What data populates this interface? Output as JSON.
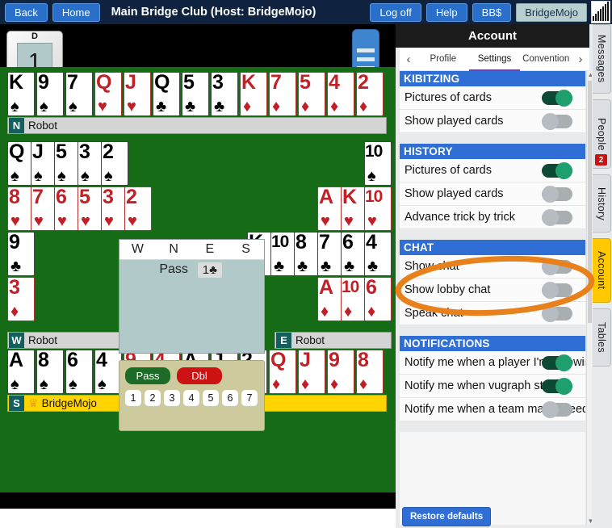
{
  "topbar": {
    "back_label": "Back",
    "home_label": "Home",
    "title": "Main Bridge Club (Host: BridgeMojo)",
    "logoff_label": "Log off",
    "help_label": "Help",
    "bbs_label": "BB$",
    "user_label": "BridgeMojo",
    "logo_icon": "bars-logo-icon"
  },
  "table": {
    "board_number": "1",
    "dealer_marker": "D",
    "menu_icon": "hamburger-menu-icon",
    "hands": {
      "north": {
        "seat": "N",
        "player": "Robot",
        "cards": [
          {
            "rank": "K",
            "suit": "♠",
            "color": "black"
          },
          {
            "rank": "9",
            "suit": "♠",
            "color": "black"
          },
          {
            "rank": "7",
            "suit": "♠",
            "color": "black"
          },
          {
            "rank": "Q",
            "suit": "♥",
            "color": "red"
          },
          {
            "rank": "J",
            "suit": "♥",
            "color": "red"
          },
          {
            "rank": "Q",
            "suit": "♣",
            "color": "black"
          },
          {
            "rank": "5",
            "suit": "♣",
            "color": "black"
          },
          {
            "rank": "3",
            "suit": "♣",
            "color": "black"
          },
          {
            "rank": "K",
            "suit": "♦",
            "color": "red"
          },
          {
            "rank": "7",
            "suit": "♦",
            "color": "red"
          },
          {
            "rank": "5",
            "suit": "♦",
            "color": "red"
          },
          {
            "rank": "4",
            "suit": "♦",
            "color": "red"
          },
          {
            "rank": "2",
            "suit": "♦",
            "color": "red"
          }
        ]
      },
      "west": {
        "seat": "W",
        "player": "Robot",
        "rows": [
          {
            "offset": 0,
            "cards": [
              {
                "rank": "Q",
                "suit": "♠",
                "color": "black"
              },
              {
                "rank": "J",
                "suit": "♠",
                "color": "black"
              },
              {
                "rank": "5",
                "suit": "♠",
                "color": "black"
              },
              {
                "rank": "3",
                "suit": "♠",
                "color": "black"
              },
              {
                "rank": "2",
                "suit": "♠",
                "color": "black"
              }
            ]
          },
          {
            "offset": 0,
            "cards": [
              {
                "rank": "8",
                "suit": "♥",
                "color": "red"
              },
              {
                "rank": "7",
                "suit": "♥",
                "color": "red"
              },
              {
                "rank": "6",
                "suit": "♥",
                "color": "red"
              },
              {
                "rank": "5",
                "suit": "♥",
                "color": "red"
              },
              {
                "rank": "3",
                "suit": "♥",
                "color": "red"
              },
              {
                "rank": "2",
                "suit": "♥",
                "color": "red"
              }
            ]
          },
          {
            "offset": 0,
            "cards": [
              {
                "rank": "9",
                "suit": "♣",
                "color": "black"
              }
            ]
          },
          {
            "offset": 0,
            "cards": [
              {
                "rank": "3",
                "suit": "♦",
                "color": "red"
              }
            ]
          }
        ]
      },
      "east": {
        "seat": "E",
        "player": "Robot",
        "rows": [
          {
            "offset": 5,
            "cards": [
              {
                "rank": "10",
                "suit": "♠",
                "color": "black"
              }
            ]
          },
          {
            "offset": 3,
            "cards": [
              {
                "rank": "A",
                "suit": "♥",
                "color": "red"
              },
              {
                "rank": "K",
                "suit": "♥",
                "color": "red"
              },
              {
                "rank": "10",
                "suit": "♥",
                "color": "red"
              }
            ]
          },
          {
            "offset": 0,
            "cards": [
              {
                "rank": "K",
                "suit": "♣",
                "color": "black"
              },
              {
                "rank": "10",
                "suit": "♣",
                "color": "black"
              },
              {
                "rank": "8",
                "suit": "♣",
                "color": "black"
              },
              {
                "rank": "7",
                "suit": "♣",
                "color": "black"
              },
              {
                "rank": "6",
                "suit": "♣",
                "color": "black"
              },
              {
                "rank": "4",
                "suit": "♣",
                "color": "black"
              }
            ]
          },
          {
            "offset": 3,
            "cards": [
              {
                "rank": "A",
                "suit": "♦",
                "color": "red"
              },
              {
                "rank": "10",
                "suit": "♦",
                "color": "red"
              },
              {
                "rank": "6",
                "suit": "♦",
                "color": "red"
              }
            ]
          }
        ]
      },
      "south": {
        "seat": "S",
        "player": "BridgeMojo",
        "is_me": true,
        "crown_icon": "crown-icon",
        "cards": [
          {
            "rank": "A",
            "suit": "♠",
            "color": "black"
          },
          {
            "rank": "8",
            "suit": "♠",
            "color": "black"
          },
          {
            "rank": "6",
            "suit": "♠",
            "color": "black"
          },
          {
            "rank": "4",
            "suit": "♠",
            "color": "black"
          },
          {
            "rank": "9",
            "suit": "♥",
            "color": "red"
          },
          {
            "rank": "4",
            "suit": "♥",
            "color": "red"
          },
          {
            "rank": "A",
            "suit": "♣",
            "color": "black"
          },
          {
            "rank": "J",
            "suit": "♣",
            "color": "black"
          },
          {
            "rank": "2",
            "suit": "♣",
            "color": "black"
          },
          {
            "rank": "Q",
            "suit": "♦",
            "color": "red"
          },
          {
            "rank": "J",
            "suit": "♦",
            "color": "red"
          },
          {
            "rank": "9",
            "suit": "♦",
            "color": "red"
          },
          {
            "rank": "8",
            "suit": "♦",
            "color": "red"
          }
        ]
      }
    },
    "auction": {
      "headers": [
        "W",
        "N",
        "E",
        "S"
      ],
      "rows": [
        [
          {
            "text": "",
            "highlight": false
          },
          {
            "text": "Pass",
            "highlight": false
          },
          {
            "text": "1♣",
            "highlight": true
          },
          {
            "text": "",
            "highlight": false
          }
        ]
      ]
    },
    "bidpad": {
      "pass_label": "Pass",
      "dbl_label": "Dbl",
      "levels": [
        "1",
        "2",
        "3",
        "4",
        "5",
        "6",
        "7"
      ]
    }
  },
  "panel": {
    "header_title": "Account",
    "prev_icon": "chevron-left-icon",
    "next_icon": "chevron-right-icon",
    "tabs": [
      {
        "label": "Profile",
        "active": false
      },
      {
        "label": "Settings",
        "active": true
      },
      {
        "label": "Convention",
        "active": false
      }
    ],
    "sections": [
      {
        "title": "KIBITZING",
        "options": [
          {
            "label": "Pictures of cards",
            "state": "on"
          },
          {
            "label": "Show played cards",
            "state": "off"
          }
        ]
      },
      {
        "title": "HISTORY",
        "options": [
          {
            "label": "Pictures of cards",
            "state": "on"
          },
          {
            "label": "Show played cards",
            "state": "off"
          },
          {
            "label": "Advance trick by trick",
            "state": "off"
          }
        ]
      },
      {
        "title": "CHAT",
        "options": [
          {
            "label": "Show chat",
            "state": "off"
          },
          {
            "label": "Show lobby chat",
            "state": "off"
          },
          {
            "label": "Speak chat",
            "state": "off"
          }
        ]
      },
      {
        "title": "NOTIFICATIONS",
        "options": [
          {
            "label": "Notify me when a player I'm following is on",
            "state": "on"
          },
          {
            "label": "Notify me when vugraph starts",
            "state": "on"
          },
          {
            "label": "Notify me when a team match needs",
            "state": "off"
          }
        ]
      }
    ],
    "restore_label": "Restore defaults"
  },
  "rail": {
    "tabs": [
      {
        "label": "Messages",
        "active": false,
        "badge": null
      },
      {
        "label": "People",
        "active": false,
        "badge": "2"
      },
      {
        "label": "History",
        "active": false,
        "badge": null
      },
      {
        "label": "Account",
        "active": true,
        "badge": null
      },
      {
        "label": "Tables",
        "active": false,
        "badge": null
      }
    ]
  },
  "annotation": {
    "shape": "ellipse-highlight",
    "color": "#e8811c"
  },
  "colors": {
    "topbar_bg": "#0f2340",
    "button_blue": "#2a6fc9",
    "felt_green": "#166b16",
    "section_blue": "#2f6ed5",
    "toggle_on": "#1f9e6e",
    "toggle_off": "#b6bcc2",
    "active_tab_yellow": "#ffc800",
    "annotation_orange": "#e8811c"
  }
}
